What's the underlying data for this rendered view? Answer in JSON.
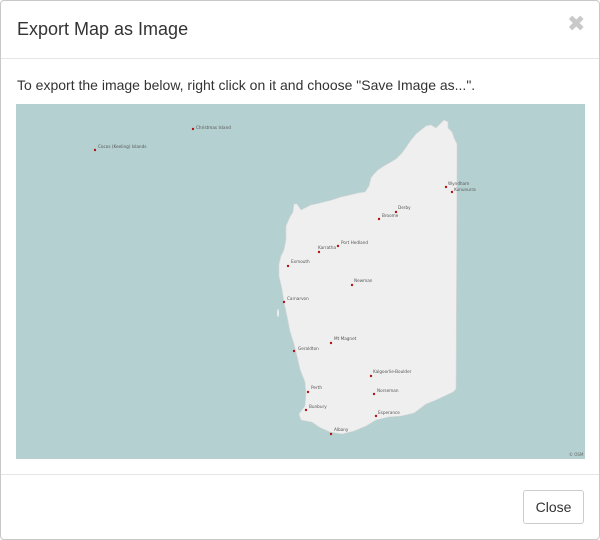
{
  "dialog": {
    "title": "Export Map as Image",
    "close_icon": "close-icon",
    "close_glyph": "✖",
    "instructions": "To export the image below, right click on it and choose \"Save Image as...\".",
    "footer": {
      "close_label": "Close"
    }
  },
  "map": {
    "water_color": "#b5d0d0",
    "land_color": "#efefef",
    "marker_color": "#b01414",
    "attribution": "© OSM",
    "places": [
      {
        "name": "Christmas Island"
      },
      {
        "name": "Cocos (Keeling) Islands"
      },
      {
        "name": "Wyndham"
      },
      {
        "name": "Kununurra"
      },
      {
        "name": "Derby"
      },
      {
        "name": "Broome"
      },
      {
        "name": "Port Hedland"
      },
      {
        "name": "Karratha"
      },
      {
        "name": "Exmouth"
      },
      {
        "name": "Newman"
      },
      {
        "name": "Carnarvon"
      },
      {
        "name": "Mt Magnet"
      },
      {
        "name": "Geraldton"
      },
      {
        "name": "Kalgoorlie-Boulder"
      },
      {
        "name": "Perth"
      },
      {
        "name": "Norseman"
      },
      {
        "name": "Bunbury"
      },
      {
        "name": "Esperance"
      },
      {
        "name": "Albany"
      }
    ]
  }
}
